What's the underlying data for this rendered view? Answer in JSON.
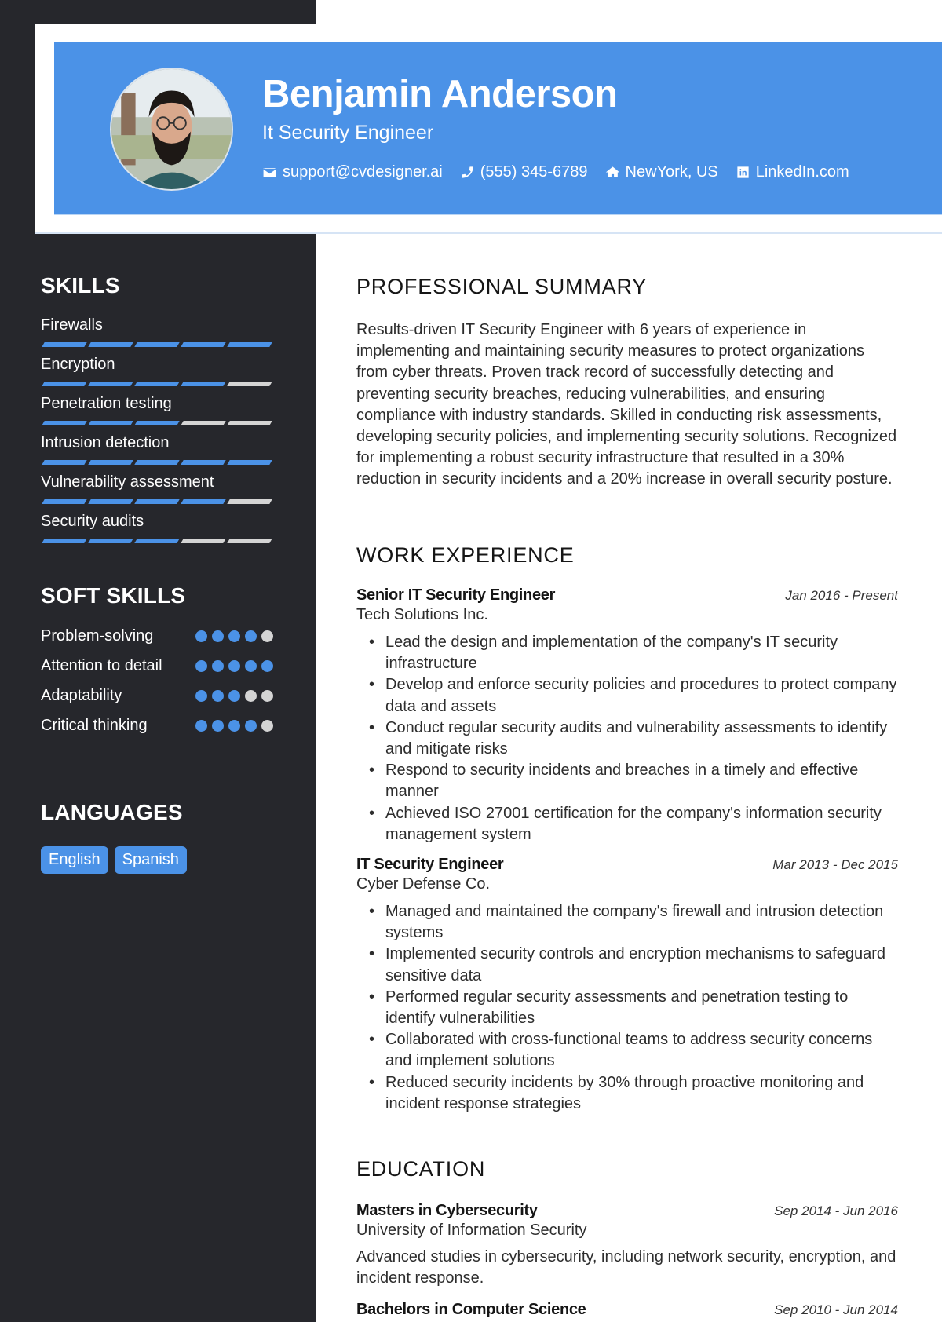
{
  "header": {
    "name": "Benjamin Anderson",
    "title": "It Security Engineer",
    "contacts": [
      {
        "icon": "envelope-icon",
        "text": "support@cvdesigner.ai"
      },
      {
        "icon": "phone-icon",
        "text": "(555) 345-6789"
      },
      {
        "icon": "home-icon",
        "text": "NewYork, US"
      },
      {
        "icon": "linkedin-icon",
        "text": "LinkedIn.com"
      }
    ]
  },
  "sidebar": {
    "skills_heading": "SKILLS",
    "skills": [
      {
        "label": "Firewalls",
        "level": 5,
        "max": 5
      },
      {
        "label": "Encryption",
        "level": 4,
        "max": 5
      },
      {
        "label": "Penetration testing",
        "level": 3,
        "max": 5
      },
      {
        "label": "Intrusion detection",
        "level": 5,
        "max": 5
      },
      {
        "label": "Vulnerability assessment",
        "level": 4,
        "max": 5
      },
      {
        "label": "Security audits",
        "level": 3,
        "max": 5
      }
    ],
    "soft_skills_heading": "SOFT SKILLS",
    "soft_skills": [
      {
        "label": "Problem-solving",
        "level": 4,
        "max": 5
      },
      {
        "label": "Attention to detail",
        "level": 5,
        "max": 5
      },
      {
        "label": "Adaptability",
        "level": 3,
        "max": 5
      },
      {
        "label": "Critical thinking",
        "level": 4,
        "max": 5
      }
    ],
    "languages_heading": "LANGUAGES",
    "languages": [
      "English",
      "Spanish"
    ]
  },
  "main": {
    "summary_heading": "PROFESSIONAL SUMMARY",
    "summary": "Results-driven IT Security Engineer with 6 years of experience in implementing and maintaining security measures to protect organizations from cyber threats. Proven track record of successfully detecting and preventing security breaches, reducing vulnerabilities, and ensuring compliance with industry standards. Skilled in conducting risk assessments, developing security policies, and implementing security solutions. Recognized for implementing a robust security infrastructure that resulted in a 30% reduction in security incidents and a 20% increase in overall security posture.",
    "experience_heading": "WORK EXPERIENCE",
    "jobs": [
      {
        "title": "Senior IT Security Engineer",
        "date": "Jan 2016 - Present",
        "company": "Tech Solutions Inc.",
        "bullets": [
          "Lead the design and implementation of the company's IT security infrastructure",
          "Develop and enforce security policies and procedures to protect company data and assets",
          "Conduct regular security audits and vulnerability assessments to identify and mitigate risks",
          "Respond to security incidents and breaches in a timely and effective manner",
          "Achieved ISO 27001 certification for the company's information security management system"
        ]
      },
      {
        "title": "IT Security Engineer",
        "date": "Mar 2013 - Dec 2015",
        "company": "Cyber Defense Co.",
        "bullets": [
          "Managed and maintained the company's firewall and intrusion detection systems",
          "Implemented security controls and encryption mechanisms to safeguard sensitive data",
          "Performed regular security assessments and penetration testing to identify vulnerabilities",
          "Collaborated with cross-functional teams to address security concerns and implement solutions",
          "Reduced security incidents by 30% through proactive monitoring and incident response strategies"
        ]
      }
    ],
    "education_heading": "EDUCATION",
    "education": [
      {
        "degree": "Masters in Cybersecurity",
        "date": "Sep 2014 - Jun 2016",
        "school": "University of Information Security",
        "description": "Advanced studies in cybersecurity, including network security, encryption, and incident response."
      },
      {
        "degree": "Bachelors in Computer Science",
        "date": "Sep 2010 - Jun 2014"
      }
    ]
  }
}
